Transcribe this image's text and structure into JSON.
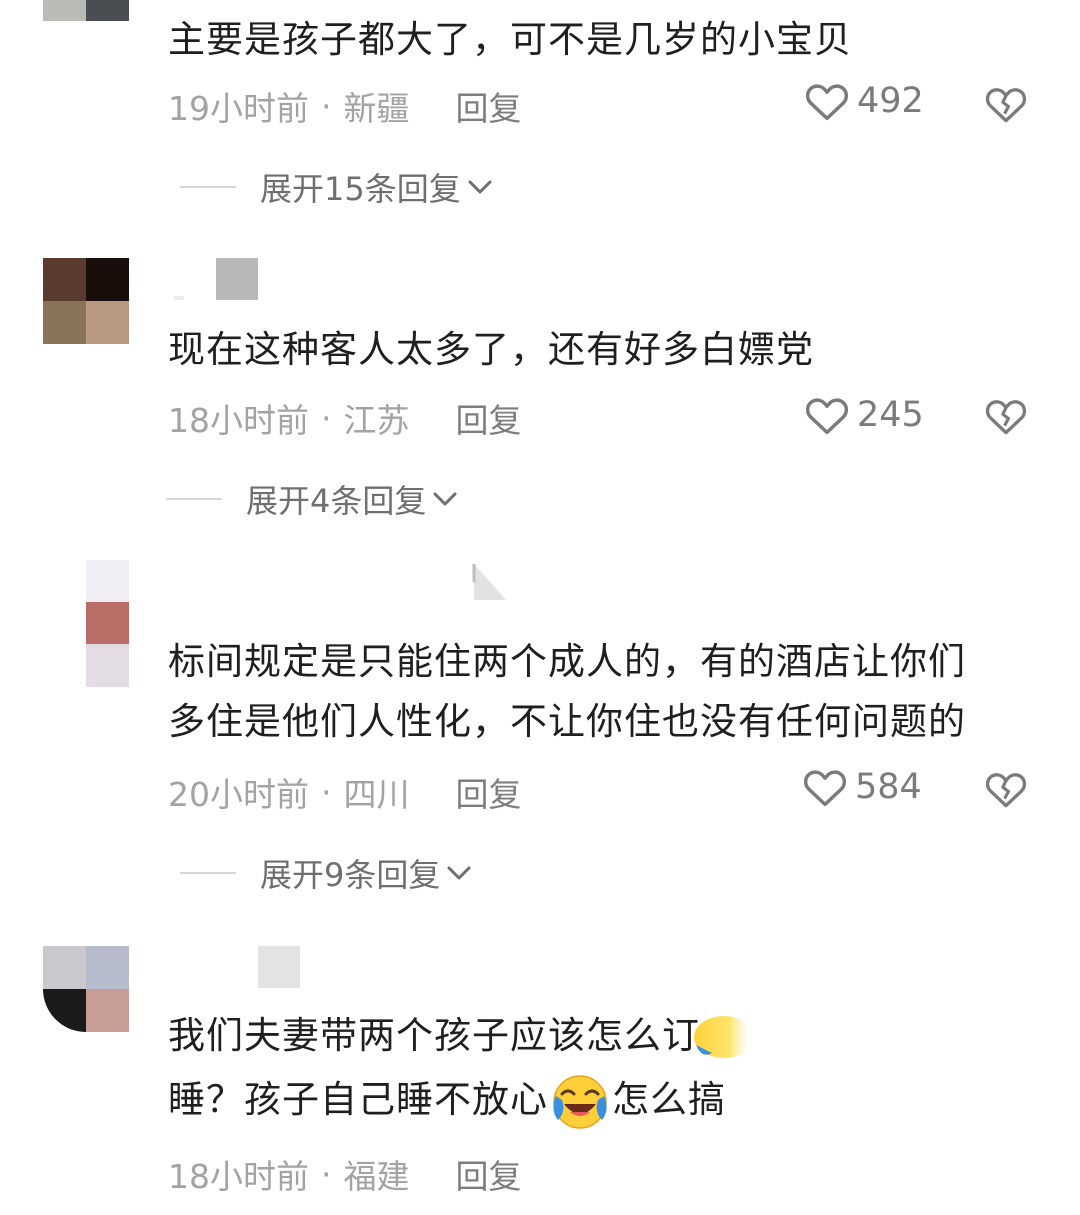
{
  "comments": [
    {
      "text_lines": [
        "主要是孩子都大了，可不是几岁的小宝贝"
      ],
      "time": "19小时前",
      "location": "新疆",
      "reply_label": "回复",
      "likes": "492",
      "expand_label": "展开15条回复",
      "avatar_colors": [
        "#b9bcb4",
        "#4a4e52",
        "#ffffff",
        "#ffffff"
      ]
    },
    {
      "text_lines": [
        "现在这种客人太多了，还有好多白嫖党"
      ],
      "time": "18小时前",
      "location": "江苏",
      "reply_label": "回复",
      "likes": "245",
      "expand_label": "展开4条回复",
      "avatar_colors": [
        "#5b3a30",
        "#1a0e0a",
        "#8a7458",
        "#b99a80"
      ]
    },
    {
      "text_lines": [
        "标间规定是只能住两个成人的，有的酒店让你们",
        "多住是他们人性化，不让你住也没有任何问题的"
      ],
      "time": "20小时前",
      "location": "四川",
      "reply_label": "回复",
      "likes": "584",
      "expand_label": "展开9条回复",
      "avatar_colors": [
        "#f1eff3",
        "#b86e66",
        "#e3dde3"
      ]
    },
    {
      "text_line_1": "我们夫妻带两个孩子应该怎么订",
      "text_line_2_a": "睡？孩子自己睡不放心",
      "text_line_2_b": "怎么搞",
      "time": "18小时前",
      "location": "福建",
      "reply_label": "回复",
      "avatar_colors": [
        "#c9c8cc",
        "#b6bccb",
        "#1a1a1a",
        "#c89d98"
      ]
    }
  ],
  "separator": "·",
  "icons": {
    "like": "heart-outline-icon",
    "dislike": "broken-heart-icon",
    "expand": "chevron-down-icon",
    "emoji": "laughing-crying-emoji-icon"
  },
  "colors": {
    "text": "#1f1f1f",
    "meta": "#a3a3a3",
    "icon": "#7b7b7b"
  }
}
